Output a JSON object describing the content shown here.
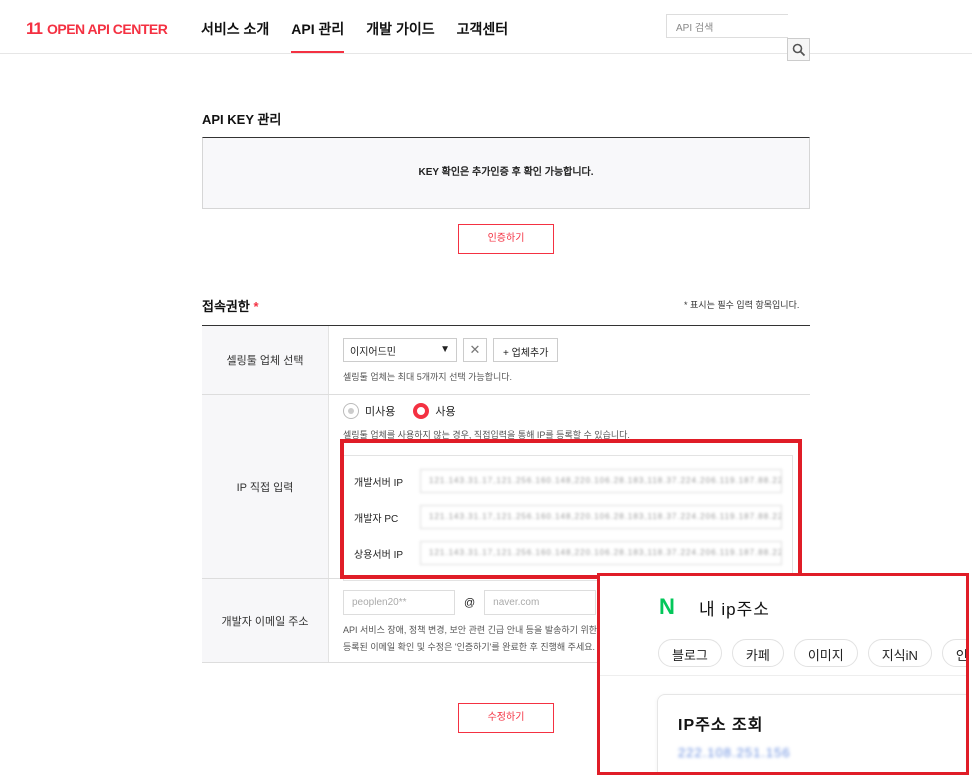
{
  "header": {
    "logo_mark": "11",
    "logo_text": "OPEN API CENTER",
    "nav": [
      "서비스 소개",
      "API 관리",
      "개발 가이드",
      "고객센터"
    ],
    "active_nav": "API 관리",
    "search_placeholder": "API 검색"
  },
  "api_key": {
    "title": "API KEY 관리",
    "notice": "KEY 확인은 추가인증 후 확인 가능합니다.",
    "auth_button": "인증하기"
  },
  "access": {
    "title": "접속권한",
    "star": "*",
    "required_note": "* 표시는 필수 입력 항목입니다.",
    "seller_tool": {
      "label": "셀링툴 업체 선택",
      "selected": "이지어드민",
      "remove": "✕",
      "add_button": "+ 업체추가",
      "help": "셀링툴 업체는 최대 5개까지 선택 가능합니다."
    },
    "ip_direct": {
      "label": "IP 직접 입력",
      "options": [
        "미사용",
        "사용"
      ],
      "selected": "사용",
      "help": "셀링툴 업체를 사용하지 않는 경우, 직접입력을 통해 IP를 등록할 수 있습니다.",
      "rows": [
        {
          "label": "개발서버 IP",
          "value": "121.143.31.17,121.256.160.148,220.106.28.183,118.37.224.206.119.187.88.227"
        },
        {
          "label": "개발자 PC",
          "value": "121.143.31.17,121.256.160.148,220.106.28.183,118.37.224.206.119.187.88.227"
        },
        {
          "label": "상용서버 IP",
          "value": "121.143.31.17,121.256.160.148,220.106.28.183,118.37.224.206.119.187.88.227"
        }
      ]
    },
    "email": {
      "label": "개발자 이메일 주소",
      "local": "peoplen20**",
      "at": "@",
      "domain": "naver.com",
      "help1": "API 서비스 장애, 정책 변경, 보안 관련 긴급 안내 등을 발송하기 위한",
      "help2": "등록된 이메일 확인 및 수정은 '인증하기'를 완료한 후 진행해 주세요."
    }
  },
  "edit_button": "수정하기",
  "popup": {
    "logo": "N",
    "title": "내 ip주소",
    "chips": [
      "블로그",
      "카페",
      "이미지",
      "지식iN",
      "인"
    ],
    "card_title": "IP주소 조회",
    "ip_value": "222.108.251.156"
  },
  "colors": {
    "accent": "#f43142",
    "highlight": "#e01d27",
    "naver_green": "#03c75a"
  }
}
